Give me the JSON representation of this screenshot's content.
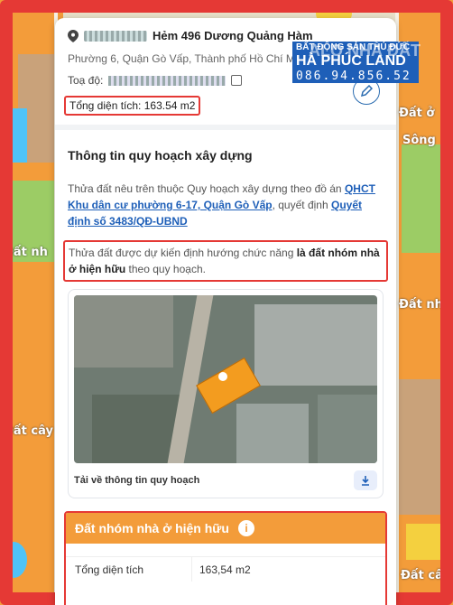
{
  "address": {
    "street": "Hẻm 496 Dương Quảng Hàm",
    "ward_city": "Phường 6, Quận Gò Vấp, Thành phố Hồ Chí Minh",
    "coord_label": "Toạ độ:",
    "area_text": "Tổng diện tích: 163.54 m2"
  },
  "planning": {
    "section_title": "Thông tin quy hoạch xây dựng",
    "para1_prefix": "Thửa đất nêu trên thuộc Quy hoạch xây dựng theo đồ án ",
    "para1_link1": "QHCT Khu dân cư phường 6-17, Quận Gò Vấp",
    "para1_middle": ", quyết định ",
    "para1_link2": "Quyết định số 3483/QĐ-UBND",
    "para2_prefix": "Thửa đất được dự kiến định hướng chức năng ",
    "para2_bold": "là đất nhóm nhà ở hiện hữu",
    "para2_suffix": " theo quy hoạch.",
    "download_label": "Tải về thông tin quy hoạch"
  },
  "zone": {
    "title": "Đất nhóm nhà ở hiện hữu",
    "info_icon": "i",
    "area_key": "Tổng diện tích",
    "area_value": "163,54 m2"
  },
  "brand": {
    "line1": "BẤT ĐỘNG SẢN THỦ ĐỨC",
    "line2": "HÀ PHÚC LAND",
    "phone": "086.94.856.52",
    "overlay": "ALO NHÀ ĐẤT"
  },
  "map_labels": [
    "Đất cây",
    "Đất nh",
    "Sông",
    "Đất ở",
    "Đất nh",
    "Đất cây"
  ],
  "colors": {
    "accent_red": "#e53935",
    "zone_orange": "#f39c3a",
    "link_blue": "#1e5fb8"
  }
}
